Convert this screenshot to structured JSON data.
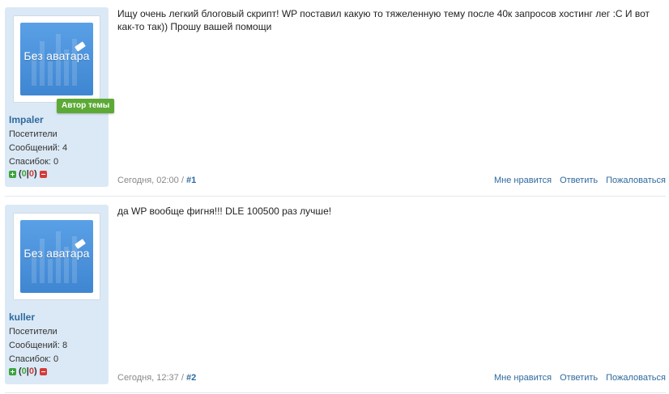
{
  "posts": [
    {
      "avatar_text": "Без аватара",
      "author_badge": "Автор темы",
      "username": "Impaler",
      "group": "Посетители",
      "messages": "Сообщений: 4",
      "thanks": "Спасибок: 0",
      "rep_open": "(",
      "rep_pos": "0",
      "rep_sep": "|",
      "rep_neg": "0",
      "rep_close": " )",
      "text": "Ищу очень легкий блоговый скрипт! WP поставил какую то тяжеленную тему после 40к запросов хостинг лег :С И вот как-то так)) Прошу вашей помощи",
      "date": "Сегодня, 02:00",
      "date_sep": " / ",
      "number": "#1",
      "like": "Мне нравится",
      "reply": "Ответить",
      "report": "Пожаловаться"
    },
    {
      "avatar_text": "Без аватара",
      "username": "kuller",
      "group": "Посетители",
      "messages": "Сообщений: 8",
      "thanks": "Спасибок: 0",
      "rep_open": "(",
      "rep_pos": "0",
      "rep_sep": "|",
      "rep_neg": "0",
      "rep_close": " )",
      "text": "да WP вообще фигня!!! DLE 100500 раз лучше!",
      "date": "Сегодня, 12:37",
      "date_sep": " / ",
      "number": "#2",
      "like": "Мне нравится",
      "reply": "Ответить",
      "report": "Пожаловаться"
    }
  ],
  "colors": {
    "sidebar_bg": "#dbe9f6",
    "username": "#2e6a9e",
    "link": "#2e6a9e",
    "badge": "#5caa35",
    "avatar": "#4a90d9"
  }
}
